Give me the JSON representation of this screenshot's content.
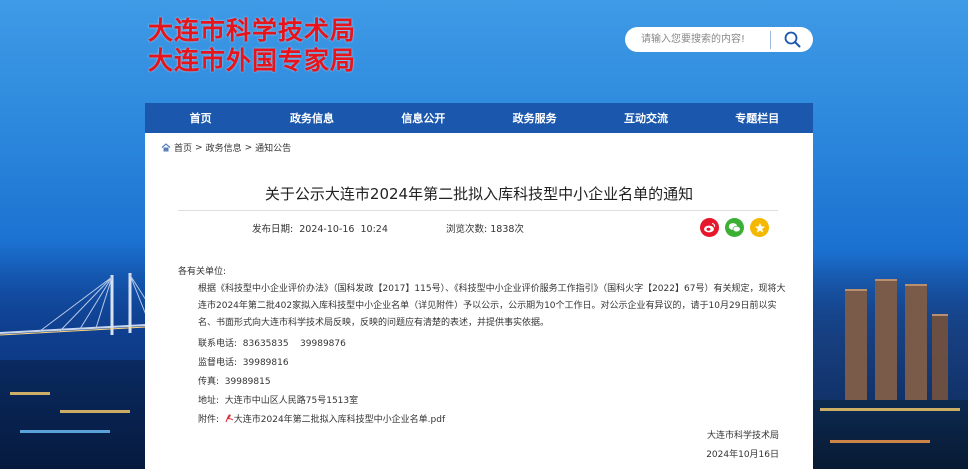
{
  "header": {
    "logo_line1": "大连市科学技术局",
    "logo_line2": "大连市外国专家局",
    "search_placeholder": "请输入您要搜索的内容!"
  },
  "nav": {
    "items": [
      {
        "label": "首页"
      },
      {
        "label": "政务信息"
      },
      {
        "label": "信息公开"
      },
      {
        "label": "政务服务"
      },
      {
        "label": "互动交流"
      },
      {
        "label": "专题栏目"
      }
    ]
  },
  "breadcrumb": {
    "home": "首页",
    "sep1": ">",
    "level1": "政务信息",
    "sep2": ">",
    "level2": "通知公告"
  },
  "article": {
    "title": "关于公示大连市2024年第二批拟入库科技型中小企业名单的通知",
    "publish_label": "发布日期:",
    "publish_date": "2024-10-16  10:24",
    "views_label": "浏览次数:",
    "views_count": "1838次",
    "greeting": "各有关单位:",
    "paragraph": "根据《科技型中小企业评价办法》（国科发政【2017】115号）、《科技型中小企业评价服务工作指引》（国科火字【2022】67号）有关规定，现将大连市2024年第二批402家拟入库科技型中小企业名单（详见附件）予以公示，公示期为10个工作日。对公示企业有异议的，请于10月29日前以实名、书面形式向大连市科学技术局反映，反映的问题应有清楚的表述，并提供事实依据。",
    "contact_label": "联系电话:",
    "contact_value": "83635835    39989876",
    "supervise_label": "监督电话:",
    "supervise_value": "39989816",
    "fax_label": "传真:",
    "fax_value": "39989815",
    "address_label": "地址:",
    "address_value": "大连市中山区人民路75号1513室",
    "attachment_label": "附件:",
    "attachment_name": "大连市2024年第二批拟入库科技型中小企业名单.pdf",
    "sign_org": "大连市科学技术局",
    "sign_date": "2024年10月16日"
  },
  "colors": {
    "logo_red": "#e8141b",
    "nav_blue": "#1a57ad",
    "weibo": "#e6162d",
    "wechat": "#3cb034",
    "favorite": "#f5b800"
  },
  "icons": {
    "search": "search-icon",
    "home": "home-icon",
    "weibo": "weibo-icon",
    "wechat": "wechat-icon",
    "favorite": "star-icon",
    "pdf": "pdf-icon"
  }
}
